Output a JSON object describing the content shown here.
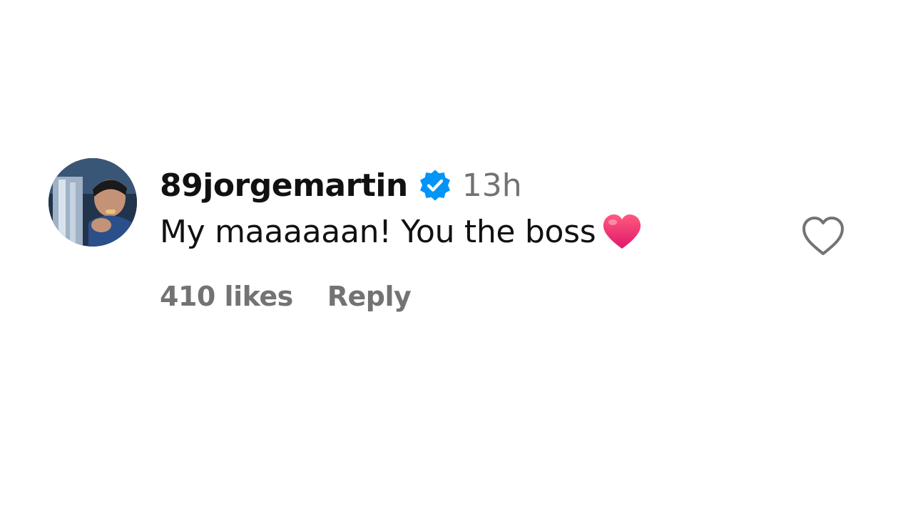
{
  "comment": {
    "username": "89jorgemartin",
    "verified_icon": "verified-badge-icon",
    "timestamp": "13h",
    "text": "My maaaaaan! You the boss",
    "emoji_icon": "red-heart-emoji-icon",
    "likes_label": "410 likes",
    "reply_label": "Reply",
    "like_icon": "heart-outline-icon"
  },
  "colors": {
    "text_primary": "#111111",
    "text_secondary": "#737373",
    "verified_blue": "#0095f6",
    "heart_red": "#f0285a"
  }
}
